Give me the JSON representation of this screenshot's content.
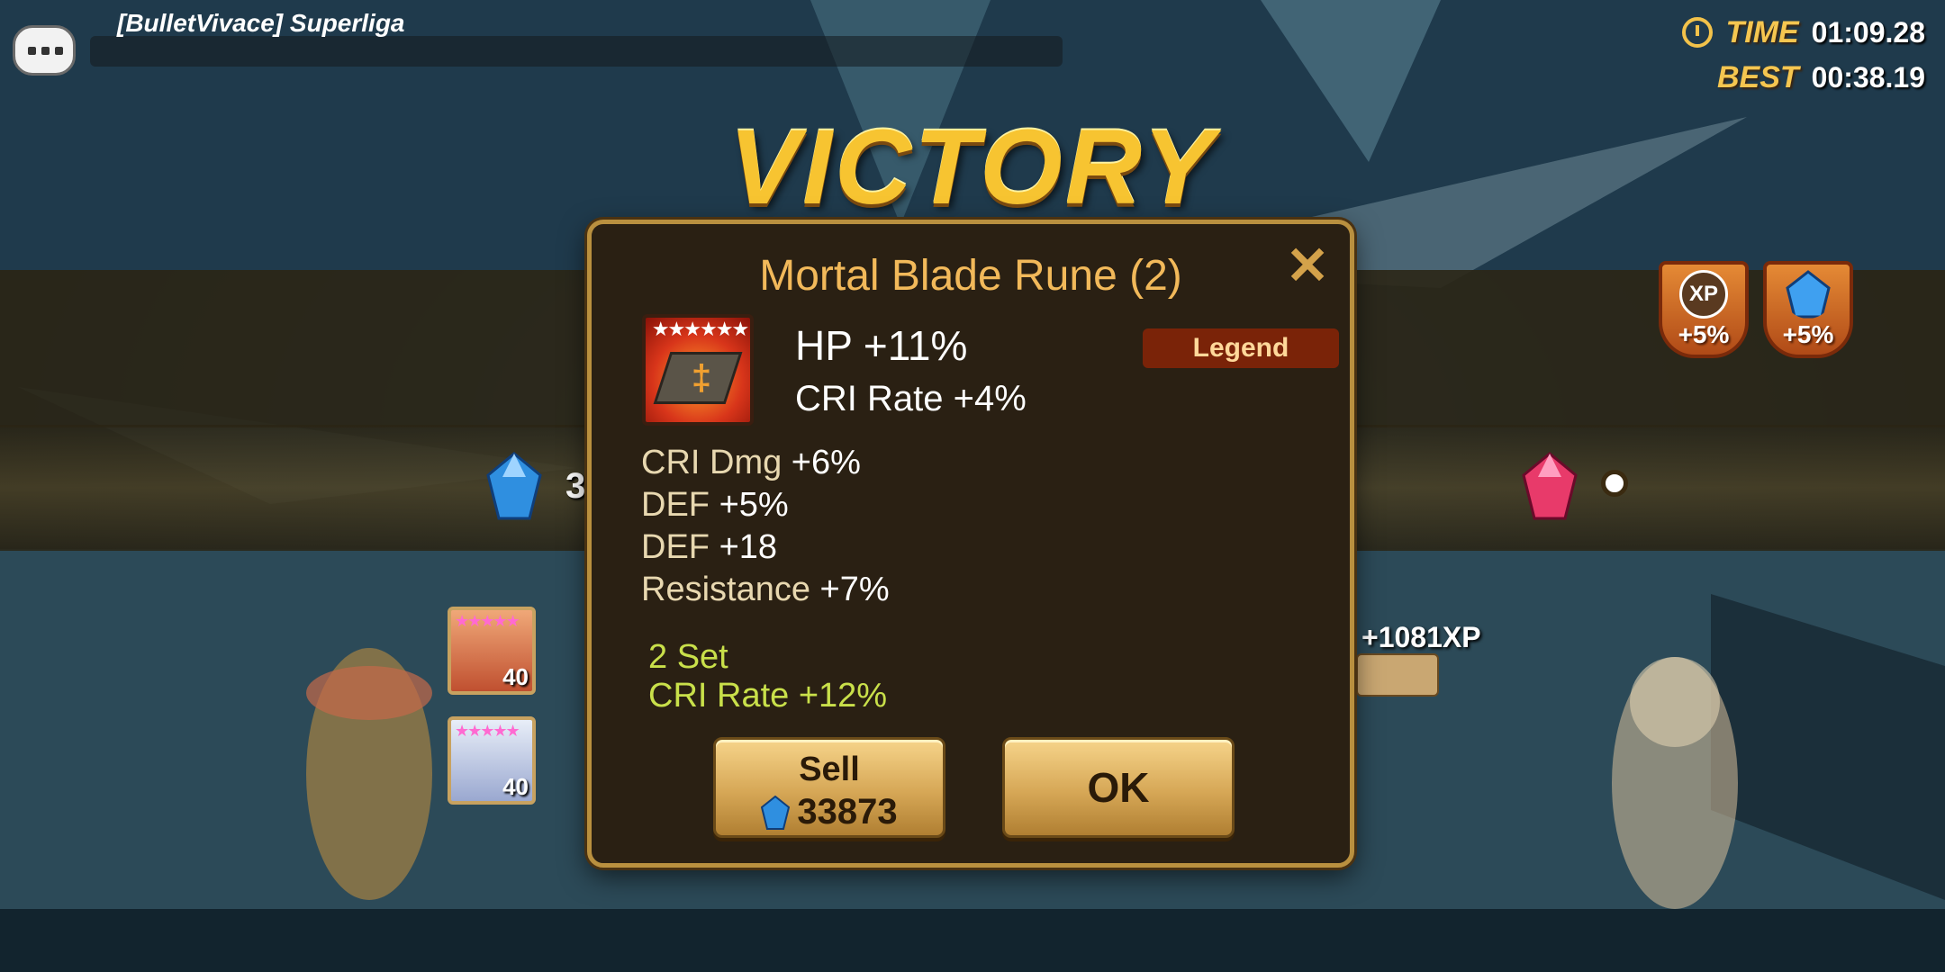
{
  "chat": {
    "message": "[BulletVivace] Superliga"
  },
  "timer": {
    "time_label": "TIME",
    "time_value": "01:09.28",
    "best_label": "BEST",
    "best_value": "00:38.19"
  },
  "banner": "VICTORY",
  "bonuses": [
    {
      "icon": "xp-icon",
      "label": "XP",
      "value": "+5%"
    },
    {
      "icon": "crystal-icon",
      "value": "+5%"
    }
  ],
  "rewards": {
    "crystal_partial": "3",
    "xp_gain": "+1081XP"
  },
  "monsters": [
    {
      "level": "40",
      "stars": "★★★★★"
    },
    {
      "level": "40",
      "stars": "★★★★★"
    }
  ],
  "rune": {
    "title": "Mortal Blade Rune (2)",
    "stars": "★★★★★★",
    "main_stat": "HP +11%",
    "innate_stat": "CRI Rate +4%",
    "grade": "Legend",
    "substats": [
      {
        "name": "CRI Dmg",
        "value": "+6%"
      },
      {
        "name": "DEF",
        "value": "+5%"
      },
      {
        "name": "DEF",
        "value": "+18"
      },
      {
        "name": "Resistance",
        "value": "+7%"
      }
    ],
    "set_label": "2 Set",
    "set_bonus": "CRI Rate +12%"
  },
  "buttons": {
    "sell_label": "Sell",
    "sell_price": "33873",
    "ok_label": "OK"
  },
  "colors": {
    "accent_gold": "#f2b95a",
    "legend_bg": "#7a2308",
    "set_green": "#c9e04a",
    "panel_bg": "#2a2013"
  }
}
